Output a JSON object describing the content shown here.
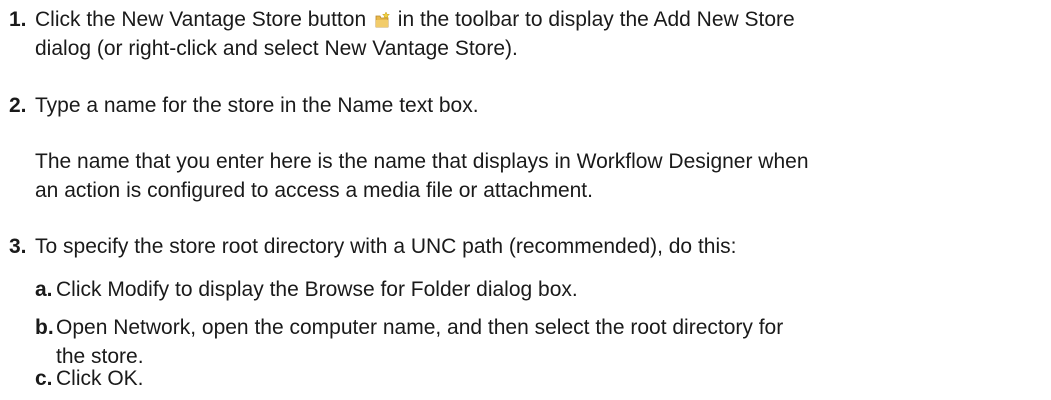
{
  "steps": [
    {
      "number": "1.",
      "line1_before_icon": "Click the New Vantage Store button ",
      "icon": "new-store-icon",
      "line1_after_icon": " in the toolbar to display the Add New Store",
      "line2": "dialog (or right-click and select New Vantage Store)."
    },
    {
      "number": "2.",
      "line1": "Type a name for the store in the Name text box."
    },
    {
      "note_line1": "The name that you enter here is the name that displays in Workflow Designer when",
      "note_line2": "an action is configured to access a media file or attachment."
    },
    {
      "number": "3.",
      "line1": "To specify the store root directory with a UNC path (recommended), do this:",
      "substeps": [
        {
          "letter": "a.",
          "line1": "Click Modify to display the Browse for Folder dialog box."
        },
        {
          "letter": "b.",
          "line1": "Open Network, open the computer name, and then select the root directory for",
          "line2": "the store."
        },
        {
          "letter": "c.",
          "line1": "Click OK."
        }
      ]
    }
  ],
  "colors": {
    "text": "#1a1a1a",
    "icon_folder": "#e8b84a",
    "icon_star": "#f0d040"
  }
}
